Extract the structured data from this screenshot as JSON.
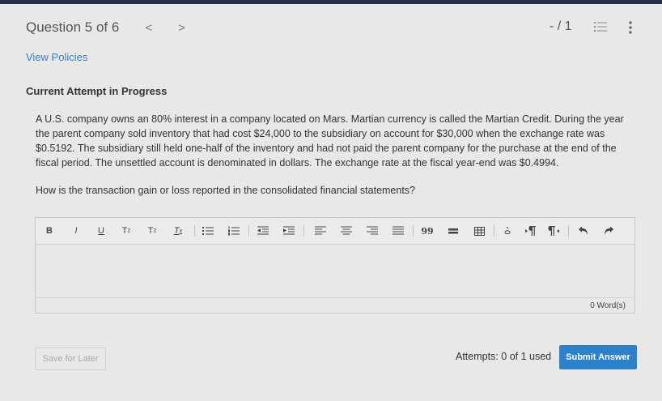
{
  "header": {
    "question_label": "Question 5 of 6",
    "prev_glyph": "<",
    "next_glyph": ">",
    "score": "- / 1"
  },
  "links": {
    "view_policies": "View Policies"
  },
  "attempt": {
    "title": "Current Attempt in Progress"
  },
  "question": {
    "text": "A U.S. company owns an 80% interest in a company located on Mars. Martian currency is called the Martian Credit. During the year the parent company sold inventory that had cost $24,000 to the subsidiary on account for $30,000 when the exchange rate was $0.5192. The subsidiary still held one-half of the inventory and had not paid the parent company for the purchase at the end of the fiscal period. The unsettled account is denominated in dollars. The exchange rate at the fiscal year-end was $0.4994.",
    "prompt": "How is the transaction gain or loss reported in the consolidated financial statements?"
  },
  "editor": {
    "toolbar": {
      "bold": "B",
      "italic": "I",
      "underline": "U",
      "subscript": "T",
      "subscript_mark": "2",
      "superscript": "T",
      "superscript_mark": "2",
      "clear_format": "T",
      "clear_mark": "x",
      "blockquote": "99"
    },
    "word_count": "0 Word(s)"
  },
  "footer": {
    "save_label": "Save for Later",
    "attempts_text": "Attempts: 0 of 1 used",
    "submit_label": "Submit Answer"
  },
  "colors": {
    "accent": "#2e80c9",
    "link": "#3a7dba",
    "topbar": "#27304a",
    "background": "#e8e8e8"
  },
  "icons": [
    "chevron-left-icon",
    "chevron-right-icon",
    "question-list-icon",
    "more-vertical-icon",
    "bulleted-list-icon",
    "numbered-list-icon",
    "indent-icon",
    "outdent-icon",
    "align-left-icon",
    "align-center-icon",
    "align-right-icon",
    "align-justify-icon",
    "blockquote-icon",
    "horizontal-rule-icon",
    "table-icon",
    "special-character-icon",
    "ltr-icon",
    "rtl-icon",
    "undo-icon",
    "redo-icon"
  ]
}
